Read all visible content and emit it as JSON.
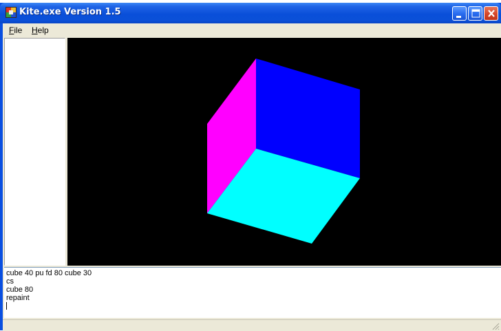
{
  "window": {
    "title": "Kite.exe Version 1.5",
    "icon": "kite-app-icon"
  },
  "title_buttons": {
    "minimize": "minimize-icon",
    "maximize": "maximize-icon",
    "close": "close-icon"
  },
  "menu": {
    "items": [
      {
        "accel": "F",
        "rest": "ile"
      },
      {
        "accel": "H",
        "rest": "elp"
      }
    ]
  },
  "canvas": {
    "background": "#000000",
    "cube_face_colors": {
      "left": "#ff00ff",
      "back": "#0000ff",
      "bottom": "#00ffff"
    }
  },
  "console": {
    "lines": [
      "cube 40 pu fd 80 cube 30",
      "cs",
      "cube 80",
      "repaint"
    ]
  },
  "colors": {
    "titlebar": "#0a4fd9",
    "client": "#ece9d8",
    "close_button": "#d4462a"
  }
}
